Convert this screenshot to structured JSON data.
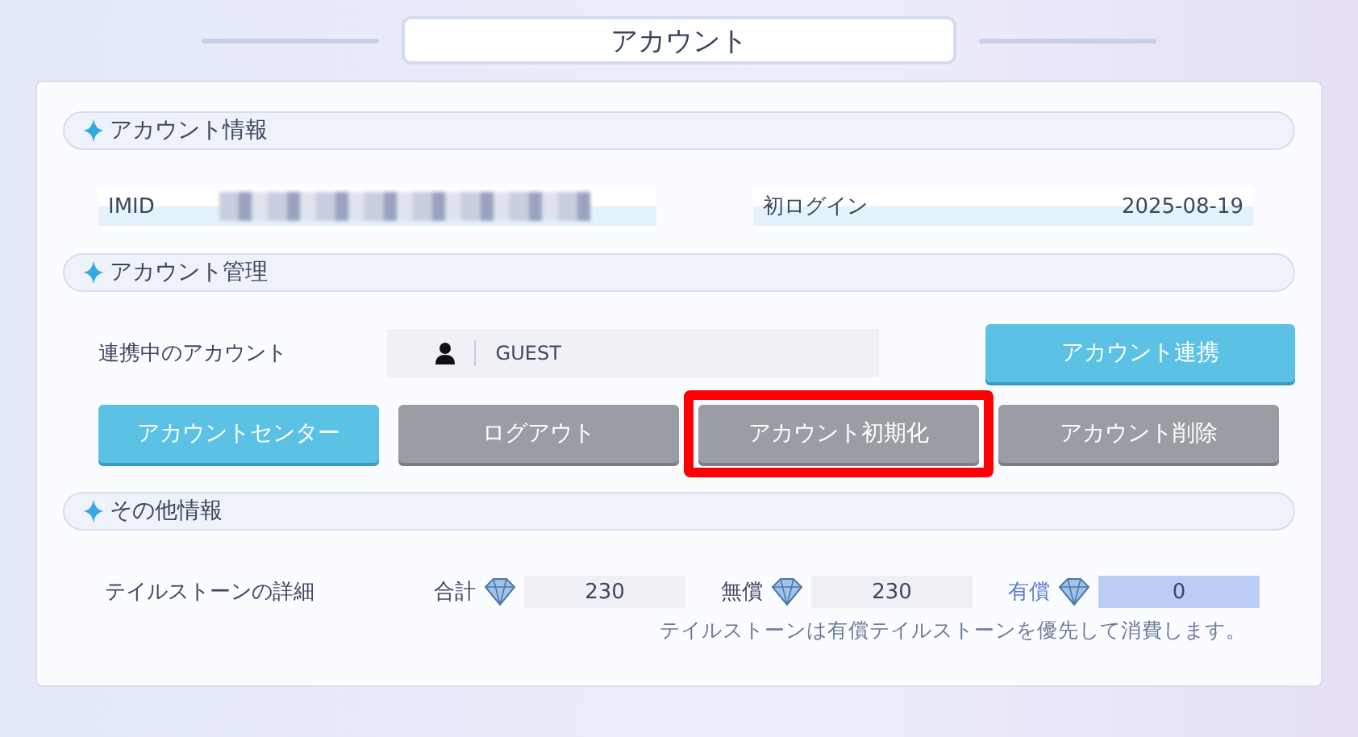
{
  "window": {
    "title": "アカウント"
  },
  "sections": [
    {
      "title": "アカウント情報"
    },
    {
      "title": "アカウント管理"
    },
    {
      "title": "その他情報"
    }
  ],
  "account_info": {
    "imid_label": "IMID",
    "first_login_label": "初ログイン",
    "first_login_value": "2025-08-19"
  },
  "account_management": {
    "linked_label": "連携中のアカウント",
    "linked_value": "GUEST",
    "link_button": {
      "label": "アカウント連携",
      "kind": "primary",
      "highlighted": false
    },
    "buttons": [
      {
        "label": "アカウントセンター",
        "kind": "primary",
        "highlighted": false
      },
      {
        "label": "ログアウト",
        "kind": "secondary",
        "highlighted": false
      },
      {
        "label": "アカウント初期化",
        "kind": "secondary",
        "highlighted": true
      },
      {
        "label": "アカウント削除",
        "kind": "secondary",
        "highlighted": false
      }
    ]
  },
  "other_info": {
    "label": "テイルストーンの詳細",
    "stones": [
      {
        "label": "合計",
        "value": "230",
        "emphasized": false
      },
      {
        "label": "無償",
        "value": "230",
        "emphasized": false
      },
      {
        "label": "有償",
        "value": "0",
        "emphasized": true
      }
    ],
    "note": "テイルストーンは有償テイルストーンを優先して消費します。"
  }
}
